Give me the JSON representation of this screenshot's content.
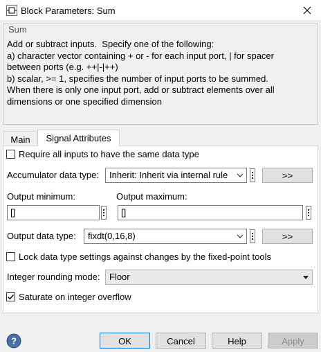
{
  "window": {
    "title": "Block Parameters: Sum",
    "icon": "simulink-block-icon",
    "close_icon": "close-icon"
  },
  "description": {
    "block_name": "Sum",
    "text": "Add or subtract inputs.  Specify one of the following:\na) character vector containing + or - for each input port, | for spacer\nbetween ports (e.g. ++|-|++)\nb) scalar, >= 1, specifies the number of input ports to be summed.\nWhen there is only one input port, add or subtract elements over all\ndimensions or one specified dimension"
  },
  "tabs": [
    {
      "label": "Main",
      "active": false
    },
    {
      "label": "Signal Attributes",
      "active": true
    }
  ],
  "signal_attributes": {
    "require_same_type": {
      "label": "Require all inputs to have the same data type",
      "checked": false
    },
    "accumulator": {
      "label": "Accumulator data type:",
      "value": "Inherit: Inherit via internal rule",
      "assistant_label": ">>"
    },
    "output_minimum": {
      "label": "Output minimum:",
      "value": "[]"
    },
    "output_maximum": {
      "label": "Output maximum:",
      "value": "[]"
    },
    "output_data_type": {
      "label": "Output data type:",
      "value": "fixdt(0,16,8)",
      "assistant_label": ">>"
    },
    "lock_data_type": {
      "label": "Lock data type settings against changes by the fixed-point tools",
      "checked": false
    },
    "rounding": {
      "label": "Integer rounding mode:",
      "value": "Floor"
    },
    "saturate": {
      "label": "Saturate on integer overflow",
      "checked": true
    }
  },
  "buttons": {
    "ok": "OK",
    "cancel": "Cancel",
    "help": "Help",
    "apply": "Apply",
    "help_icon": "help-icon"
  },
  "colors": {
    "focus_border": "#0078d7",
    "help_icon_fill": "#4a6fa5"
  }
}
